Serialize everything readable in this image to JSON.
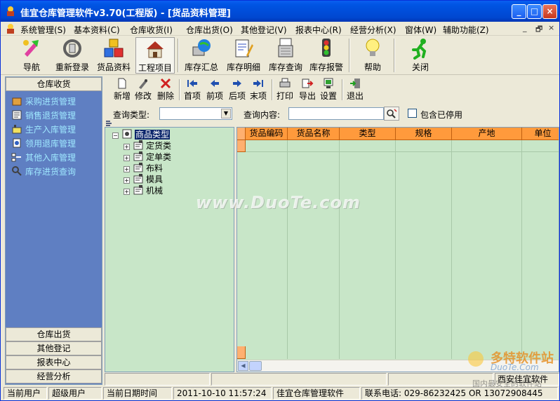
{
  "window": {
    "title": "佳宜仓库管理软件v3.70(工程版)  - [货品资料管理]",
    "controls": {
      "minimize": "_",
      "maximize": "□",
      "close": "×"
    }
  },
  "menubar": {
    "items": [
      "系统管理(S)",
      "基本资料(C)",
      "仓库收货(I)",
      "仓库出货(O)",
      "其他登记(V)",
      "报表中心(R)",
      "经营分析(X)",
      "窗体(W)",
      "辅助功能(Z)"
    ],
    "mdi_controls": {
      "minimize": "_",
      "restore": "🗗",
      "close": "×"
    }
  },
  "main_toolbar": {
    "buttons": [
      "导航",
      "重新登录",
      "货品资料",
      "工程项目",
      "库存汇总",
      "库存明细",
      "库存查询",
      "库存报警",
      "帮助",
      "关闭"
    ]
  },
  "left_panel": {
    "header": "仓库收货",
    "items": [
      "采购进货管理",
      "销售退货管理",
      "生产入库管理",
      "领用退库管理",
      "其他入库管理",
      "库存进货查询"
    ],
    "footer": [
      "仓库出货",
      "其他登记",
      "报表中心",
      "经营分析"
    ]
  },
  "sub_toolbar": {
    "buttons": [
      "新增",
      "修改",
      "删除",
      "首项",
      "前项",
      "后项",
      "末项",
      "打印",
      "导出",
      "设置",
      "退出"
    ]
  },
  "query": {
    "type_label": "查询类型:",
    "type_value": "",
    "content_label": "查询内容:",
    "content_value": "",
    "include_disabled_label": "包含已停用",
    "include_disabled_checked": false
  },
  "tree": {
    "root": "商品类型",
    "children": [
      "定货类",
      "定单类",
      "布料",
      "模具",
      "机械"
    ]
  },
  "grid": {
    "columns": [
      "货品编码",
      "货品名称",
      "类型",
      "规格",
      "产地",
      "单位"
    ],
    "rows": []
  },
  "bottom_row": {
    "right_text": "西安佳宜软件"
  },
  "statusbar": {
    "user_label": "当前用户",
    "user_value": "超级用户",
    "date_label": "当前日期时间",
    "date_value": "2011-10-10 11:57:24",
    "product": "佳宜仓库管理软件",
    "contact": "联系电话: 029-86232425  OR  13072908445"
  },
  "watermarks": {
    "center": "www.DuoTe.com",
    "corner_brand": "多特软件站",
    "corner_url": "DuoTe.Com",
    "corner_slogan": "国内最安全的软件站"
  },
  "colors": {
    "titlebar": "#0054e3",
    "left_panel_bg": "#5f7fc2",
    "left_panel_text": "#9fe8ff",
    "grid_bg": "#c8e6c8",
    "grid_header": "#ff9a3c"
  }
}
